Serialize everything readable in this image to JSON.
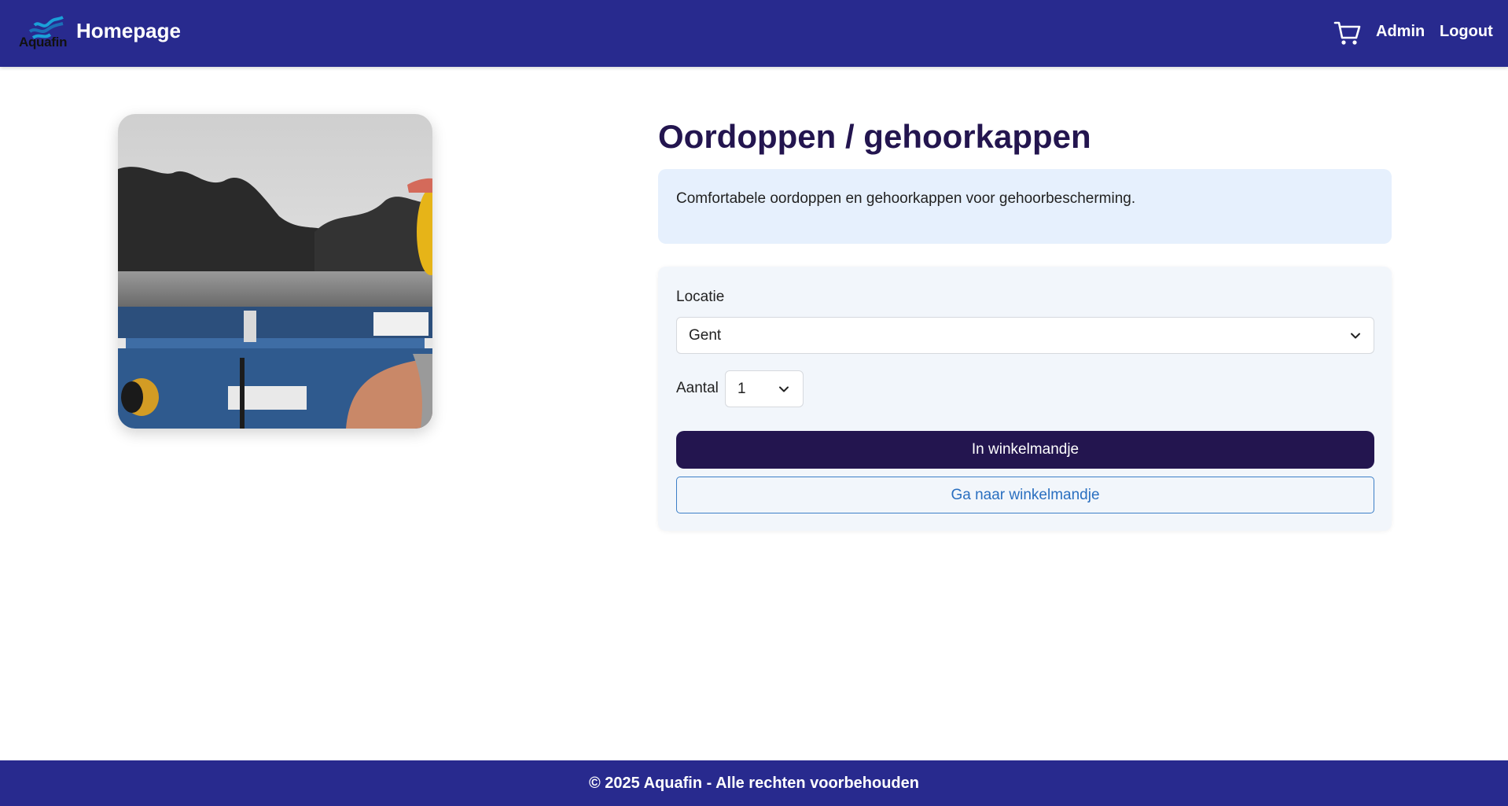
{
  "header": {
    "logo_text": "Aquafin",
    "title": "Homepage",
    "cart_icon": "cart-icon",
    "admin_label": "Admin",
    "logout_label": "Logout"
  },
  "product": {
    "title": "Oordoppen / gehoorkappen",
    "description": "Comfortabele oordoppen en gehoorkappen voor gehoorbescherming."
  },
  "order_form": {
    "location_label": "Locatie",
    "location_value": "Gent",
    "quantity_label": "Aantal",
    "quantity_value": "1",
    "add_to_cart_label": "In winkelmandje",
    "go_to_cart_label": "Ga naar winkelmandje"
  },
  "footer": {
    "text": "© 2025 Aquafin - Alle rechten voorbehouden"
  },
  "colors": {
    "navbar": "#282a8e",
    "title": "#23154f",
    "primary_button": "#23154f",
    "outline_button": "#3c7fc7",
    "description_bg": "#e6f0fd",
    "card_bg": "#f2f6fb"
  }
}
